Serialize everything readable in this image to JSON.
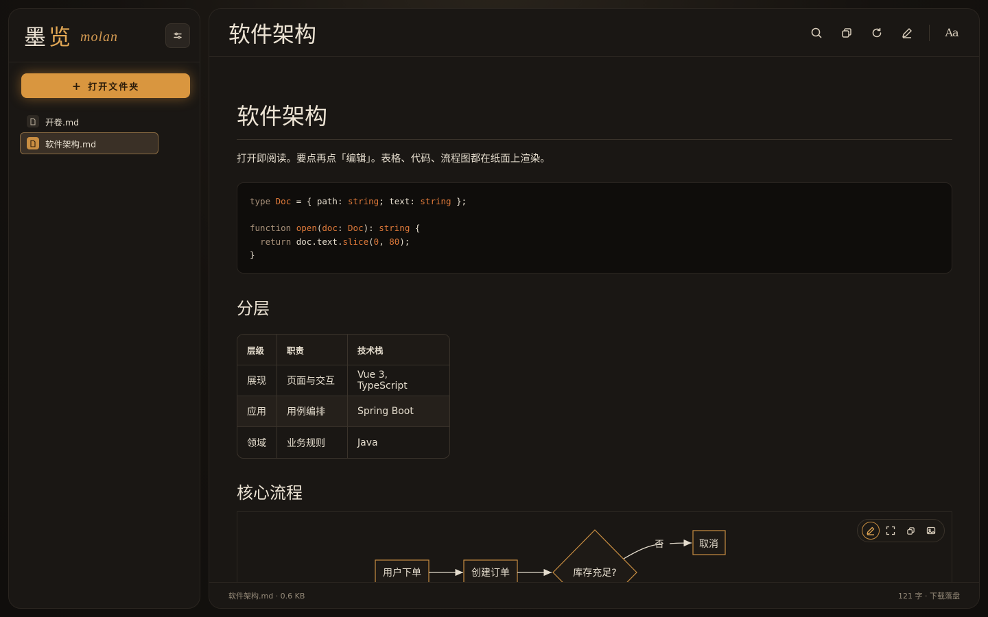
{
  "brand": {
    "cn_1": "墨",
    "cn_2": "览",
    "en": "molan"
  },
  "sidebar": {
    "open_button": "打开文件夹",
    "files": [
      {
        "name": "开卷.md",
        "active": false
      },
      {
        "name": "软件架构.md",
        "active": true
      }
    ]
  },
  "topbar": {
    "title": "软件架构",
    "actions": [
      "search-icon",
      "copy-icon",
      "refresh-icon",
      "edit-icon",
      "font-size-icon"
    ],
    "font_label": "Aa"
  },
  "doc": {
    "h1": "软件架构",
    "lead": "打开即阅读。要点再点「编辑」。表格、代码、流程图都在纸面上渲染。",
    "code_lines": [
      "type Doc = { path: string; text: string };",
      "",
      "function open(doc: Doc): string {",
      "  return doc.text.slice(0, 80);",
      "}"
    ],
    "h2_layers": "分层",
    "table": {
      "headers": [
        "层级",
        "职责",
        "技术栈"
      ],
      "rows": [
        [
          "展现",
          "页面与交互",
          "Vue 3, TypeScript"
        ],
        [
          "应用",
          "用例编排",
          "Spring Boot"
        ],
        [
          "领域",
          "业务规则",
          "Java"
        ]
      ]
    },
    "h2_flow": "核心流程",
    "flow": {
      "nodes": [
        "用户下单",
        "创建订单",
        "库存充足?",
        "取消"
      ],
      "edge_labels": [
        "否"
      ]
    }
  },
  "statusbar": {
    "left": "软件架构.md · 0.6 KB",
    "right": "121 字 · 下载落盘"
  },
  "colors": {
    "accent": "#d9963f",
    "background": "#1a1714",
    "code_keyword": "#a8917a",
    "code_type": "#e07a3a"
  }
}
